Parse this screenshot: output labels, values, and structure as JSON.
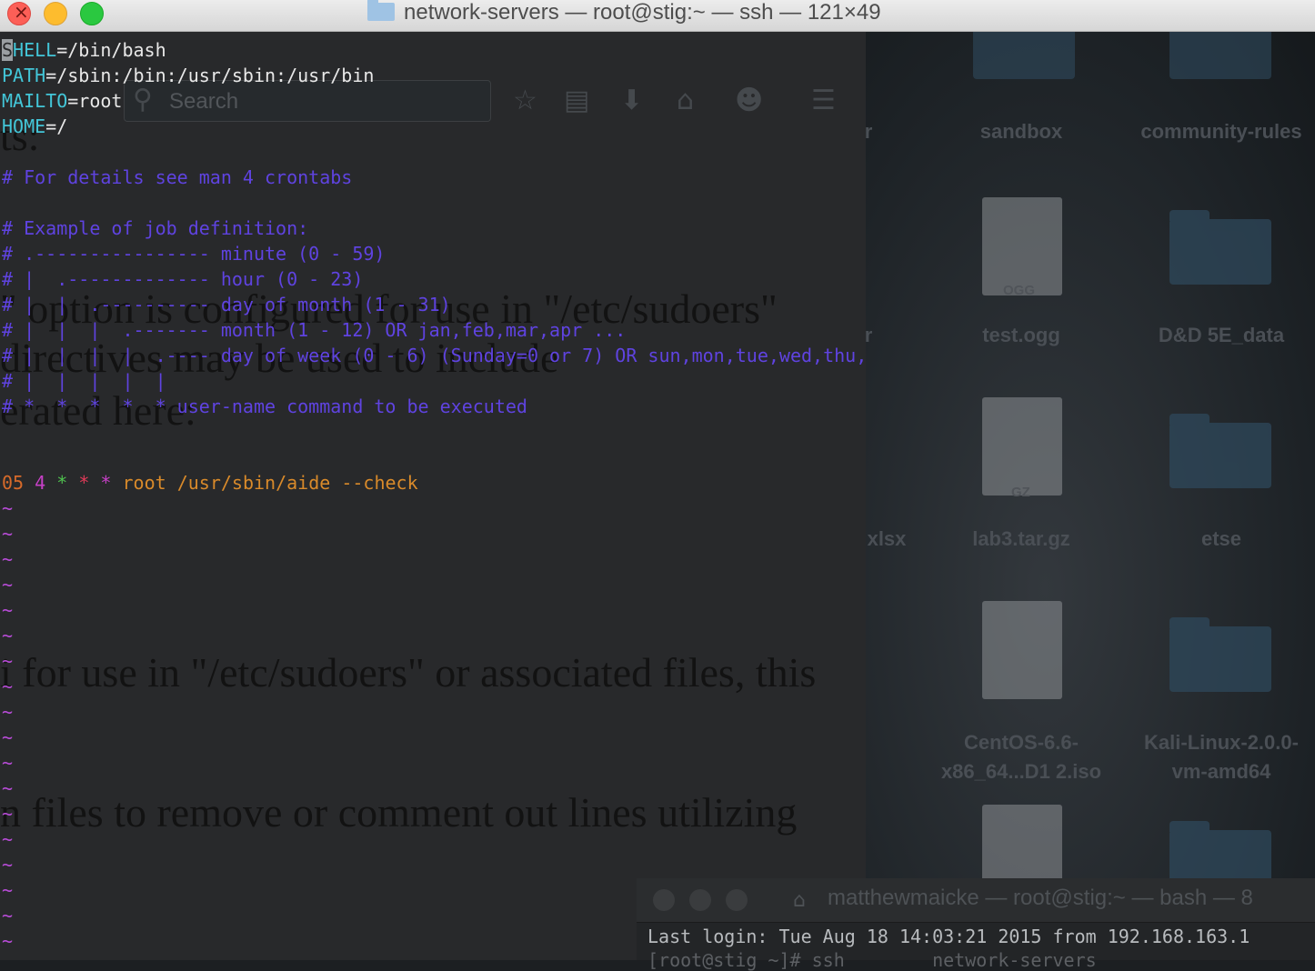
{
  "window": {
    "title": "network-servers — root@stig:~ — ssh — 121×49"
  },
  "browser_ghost": {
    "search_placeholder": "Search"
  },
  "terminal": {
    "env": [
      {
        "name": "SHELL",
        "value": "/bin/bash"
      },
      {
        "name": "PATH",
        "value": "/sbin:/bin:/usr/sbin:/usr/bin"
      },
      {
        "name": "MAILTO",
        "value": "root"
      },
      {
        "name": "HOME",
        "value": "/"
      }
    ],
    "comments": [
      "# For details see man 4 crontabs",
      "# Example of job definition:",
      "# .---------------- minute (0 - 59)",
      "# |  .------------- hour (0 - 23)",
      "# |  |  .---------- day of month (1 - 31)",
      "# |  |  |  .------- month (1 - 12) OR jan,feb,mar,apr ...",
      "# |  |  |  |  .---- day of week (0 - 6) (Sunday=0 or 7) OR sun,mon,tue,wed,thu,fri,sat",
      "# |  |  |  |  |",
      "# *  *  *  *  * user-name command to be executed"
    ],
    "cron": {
      "minute": "05",
      "hour": "4",
      "dom": "*",
      "month": "*",
      "dow": "*",
      "command": "root /usr/sbin/aide --check"
    },
    "tilde": "~"
  },
  "doc_ghost": {
    "lines": [
      "ts:",
      "\" option is configured for use in \"/etc/sudoers\"",
      " directives may be used to include",
      "erated here:",
      "i for use in \"/etc/sudoers\" or associated files, this",
      "n files to remove or comment out lines utilizing"
    ]
  },
  "desktop": {
    "items": [
      {
        "label": "sandbox"
      },
      {
        "label": "community-rules"
      },
      {
        "label": "test.ogg",
        "badge": "OGG"
      },
      {
        "label": "D&D 5E_data"
      },
      {
        "label": "lab3.tar.gz",
        "badge": "GZ"
      },
      {
        "label": "etse"
      },
      {
        "label": "CentOS-6.6-\nx86_64...D1 2.iso"
      },
      {
        "label": "Kali-Linux-2.0.0-\nvm-amd64"
      }
    ],
    "partial_labels": [
      "r",
      "r",
      "xlsx"
    ]
  },
  "second_terminal": {
    "title": "matthewmaicke — root@stig:~ — bash — 8",
    "last_login": "Last login: Tue Aug 18 14:03:21 2015 from 192.168.163.1",
    "partial_prompt": "[root@stig ~]# ssh        network-servers"
  },
  "colors": {
    "var": "#43c6d8",
    "comment": "#5f43e0",
    "number": "#d76a2a",
    "tilde": "#b84cd8"
  }
}
